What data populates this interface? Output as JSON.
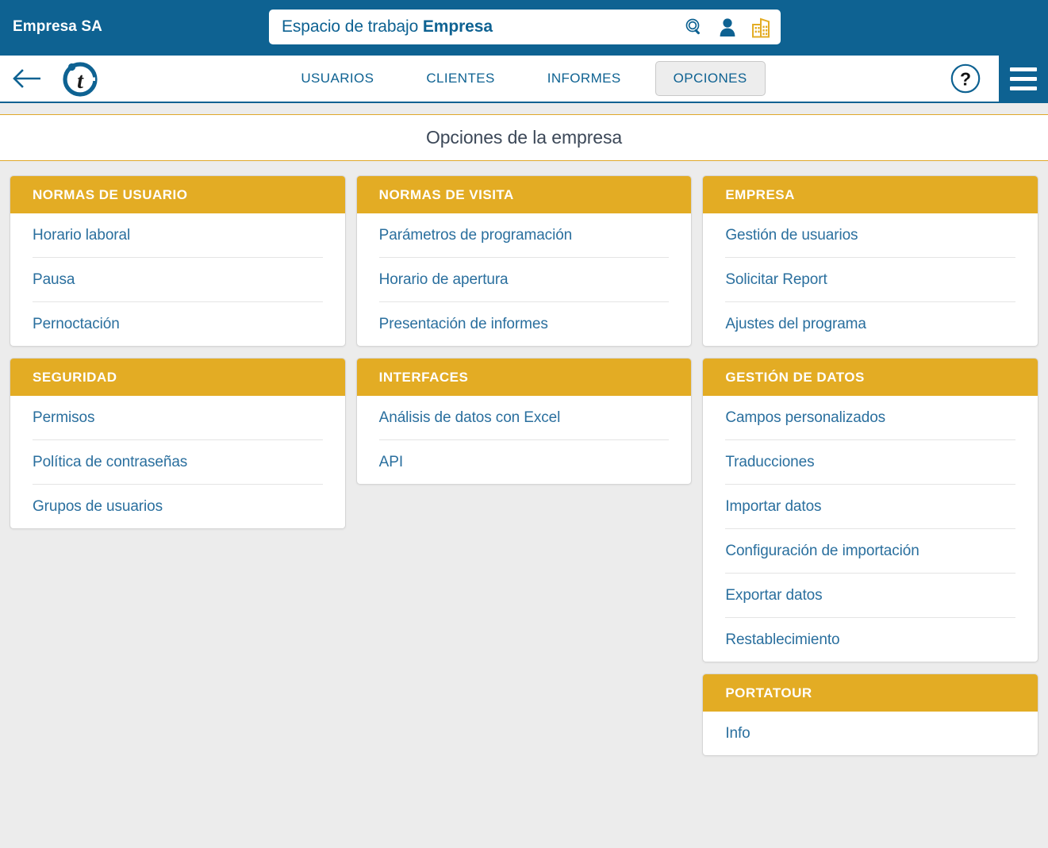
{
  "topbar": {
    "brand": "Empresa SA",
    "workspace_prefix": "Espacio de trabajo ",
    "workspace_name": "Empresa",
    "icons": [
      "search-icon",
      "user-icon",
      "company-icon"
    ]
  },
  "nav": {
    "back_label": "back-arrow-icon",
    "logo": "portatour-t-logo",
    "tabs": [
      {
        "label": "USUARIOS",
        "active": false
      },
      {
        "label": "CLIENTES",
        "active": false
      },
      {
        "label": "INFORMES",
        "active": false
      },
      {
        "label": "OPCIONES",
        "active": true
      }
    ],
    "help_label": "?",
    "menu_label": "hamburger-menu-icon"
  },
  "page": {
    "title": "Opciones de la empresa"
  },
  "columns": [
    {
      "cards": [
        {
          "header": "NORMAS DE USUARIO",
          "items": [
            "Horario laboral",
            "Pausa",
            "Pernoctación"
          ]
        },
        {
          "header": "SEGURIDAD",
          "items": [
            "Permisos",
            "Política de contraseñas",
            "Grupos de usuarios"
          ]
        }
      ]
    },
    {
      "cards": [
        {
          "header": "NORMAS DE VISITA",
          "items": [
            "Parámetros de programación",
            "Horario de apertura",
            "Presentación de informes"
          ]
        },
        {
          "header": "INTERFACES",
          "items": [
            "Análisis de datos con Excel",
            "API"
          ]
        }
      ]
    },
    {
      "cards": [
        {
          "header": "EMPRESA",
          "items": [
            "Gestión de usuarios",
            "Solicitar Report",
            "Ajustes del programa"
          ]
        },
        {
          "header": "GESTIÓN DE DATOS",
          "items": [
            "Campos personalizados",
            "Traducciones",
            "Importar datos",
            "Configuración de importación",
            "Exportar datos",
            "Restablecimiento"
          ]
        },
        {
          "header": "PORTATOUR",
          "items": [
            "Info"
          ]
        }
      ]
    }
  ],
  "colors": {
    "header_blue": "#0e6292",
    "accent_gold": "#e3ac24",
    "link_blue": "#2a6f9e",
    "page_bg": "#ececec",
    "title_text": "#3c4858"
  }
}
